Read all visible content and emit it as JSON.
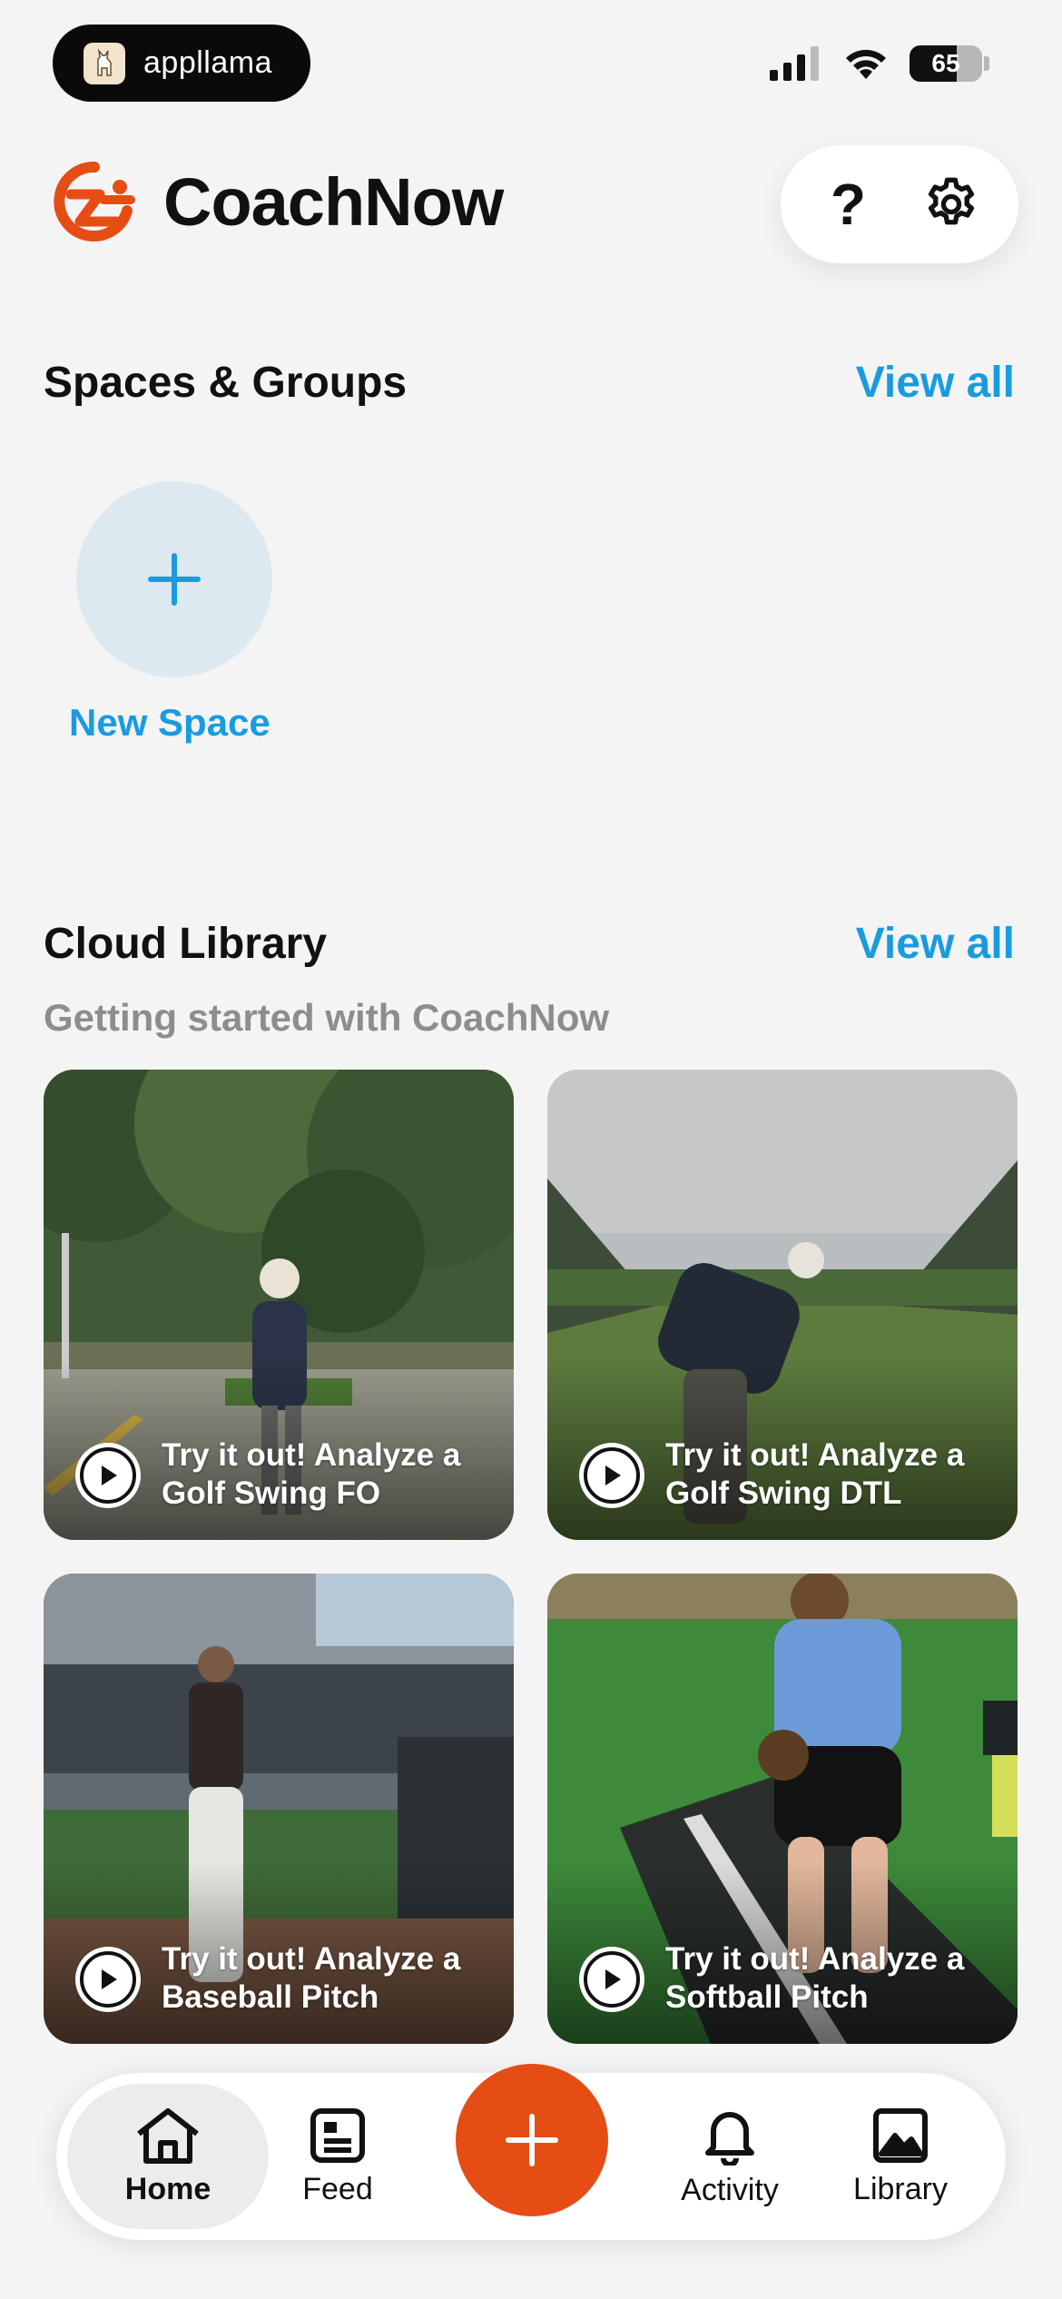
{
  "status_bar": {
    "applet_name": "appllama",
    "battery": "65",
    "battery_level": 0.65
  },
  "header": {
    "brand": "CoachNow",
    "help_label": "?",
    "brand_color": "#e54d15",
    "accent_color": "#1a9be0"
  },
  "spaces": {
    "title": "Spaces & Groups",
    "view_all": "View all",
    "new_space_label": "New Space"
  },
  "library": {
    "title": "Cloud Library",
    "view_all": "View all",
    "subtitle": "Getting started with CoachNow",
    "cards": [
      {
        "title": "Try it out! Analyze a Golf Swing FO"
      },
      {
        "title": "Try it out! Analyze a Golf Swing DTL"
      },
      {
        "title": "Try it out! Analyze a Baseball Pitch"
      },
      {
        "title": "Try it out! Analyze a Softball Pitch"
      }
    ]
  },
  "nav": {
    "home": "Home",
    "feed": "Feed",
    "activity": "Activity",
    "library": "Library"
  }
}
